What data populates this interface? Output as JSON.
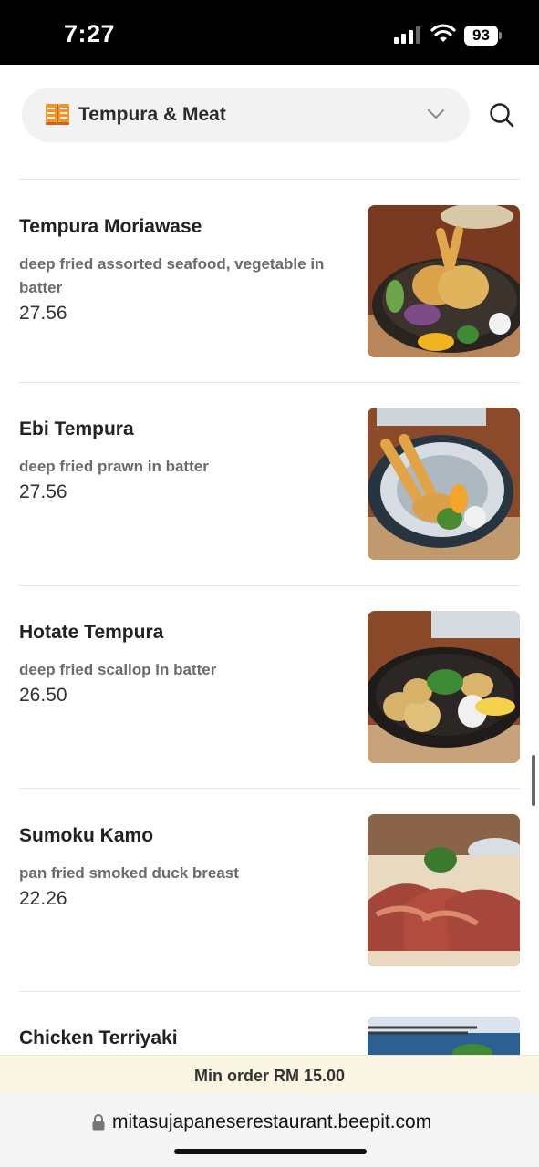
{
  "status": {
    "time": "7:27",
    "battery": "93"
  },
  "category": {
    "label": "Tempura & Meat",
    "icon": "book-icon"
  },
  "colors": {
    "accent": "#f0932b",
    "min_order_bg": "#fbf6e4"
  },
  "menu": {
    "items": [
      {
        "name": "Tempura Moriawase",
        "description": "deep fried assorted seafood, vegetable in batter",
        "price": "27.56"
      },
      {
        "name": "Ebi Tempura",
        "description": "deep fried prawn in batter",
        "price": "27.56"
      },
      {
        "name": "Hotate Tempura",
        "description": "deep fried scallop in batter",
        "price": "26.50"
      },
      {
        "name": "Sumoku Kamo",
        "description": "pan fried smoked duck breast",
        "price": "22.26"
      },
      {
        "name": "Chicken Terriyaki",
        "description": "",
        "price": ""
      }
    ]
  },
  "footer": {
    "min_order": "Min order RM 15.00",
    "url": "mitasujapaneserestaurant.beepit.com"
  }
}
